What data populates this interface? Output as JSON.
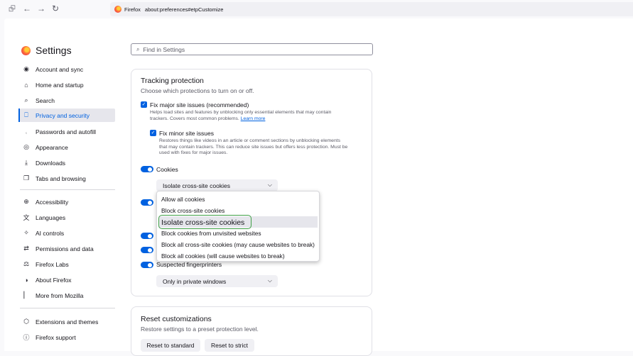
{
  "browser": {
    "identity_label": "Firefox",
    "url": "about:preferences#etpCustomize"
  },
  "sidebar": {
    "title": "Settings",
    "items": [
      {
        "label": "Account and sync"
      },
      {
        "label": "Home and startup"
      },
      {
        "label": "Search"
      },
      {
        "label": "Privacy and security"
      },
      {
        "label": "Passwords and autofill"
      },
      {
        "label": "Appearance"
      },
      {
        "label": "Downloads"
      },
      {
        "label": "Tabs and browsing"
      },
      {
        "label": "Accessibility"
      },
      {
        "label": "Languages"
      },
      {
        "label": "AI controls"
      },
      {
        "label": "Permissions and data"
      },
      {
        "label": "Firefox Labs"
      },
      {
        "label": "About Firefox"
      },
      {
        "label": "More from Mozilla"
      },
      {
        "label": "Extensions and themes"
      },
      {
        "label": "Firefox support"
      }
    ],
    "active_item": "Privacy and security"
  },
  "search": {
    "placeholder": "Find in Settings"
  },
  "tracking": {
    "title": "Tracking protection",
    "subtitle": "Choose which protections to turn on or off.",
    "fix_major": {
      "label": "Fix major site issues (recommended)",
      "desc_line1": "Helps load sites and features by unblocking only essential elements that may contain",
      "desc_line2": "trackers. Covers most common problems.",
      "learn_more": "Learn more"
    },
    "fix_minor": {
      "label": "Fix minor site issues",
      "desc_line1": "Restores things like videos in an article or comment sections by unblocking elements",
      "desc_line2": "that may contain trackers. This can reduce site issues but offers less protection. Must be",
      "desc_line3": "used with fixes for major issues."
    },
    "cookies_label": "Cookies",
    "cookies_select": "Isolate cross-site cookies",
    "fingerprinters_label": "Suspected fingerprinters",
    "fingerprinters_select": "Only in private windows"
  },
  "cookie_dropdown": {
    "options": [
      "Allow all cookies",
      "Block cross-site cookies",
      "Isolate cross-site cookies",
      "Block cookies from unvisited websites",
      "Block all cross-site cookies (may cause websites to break)",
      "Block all cookies (will cause websites to break)"
    ],
    "highlighted": "Isolate cross-site cookies",
    "highlight_color": "#3fa045"
  },
  "reset": {
    "title": "Reset customizations",
    "subtitle": "Restore settings to a preset protection level.",
    "standard_button": "Reset to standard",
    "strict_button": "Reset to strict"
  },
  "colors": {
    "accent": "#0061e0"
  }
}
